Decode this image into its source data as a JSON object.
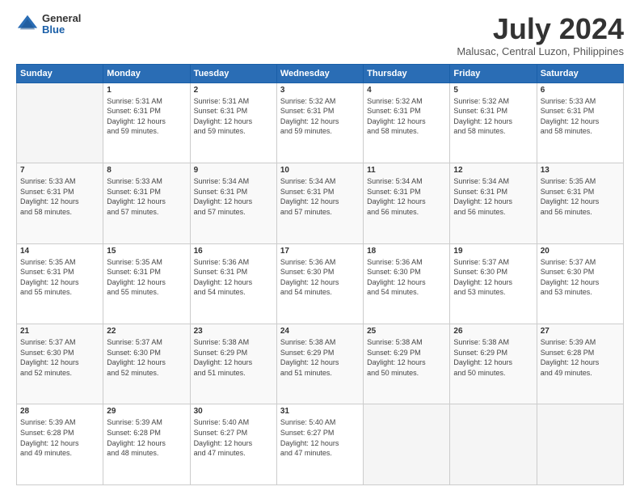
{
  "logo": {
    "general": "General",
    "blue": "Blue"
  },
  "title": "July 2024",
  "location": "Malusac, Central Luzon, Philippines",
  "days_header": [
    "Sunday",
    "Monday",
    "Tuesday",
    "Wednesday",
    "Thursday",
    "Friday",
    "Saturday"
  ],
  "weeks": [
    [
      {
        "num": "",
        "info": ""
      },
      {
        "num": "1",
        "info": "Sunrise: 5:31 AM\nSunset: 6:31 PM\nDaylight: 12 hours\nand 59 minutes."
      },
      {
        "num": "2",
        "info": "Sunrise: 5:31 AM\nSunset: 6:31 PM\nDaylight: 12 hours\nand 59 minutes."
      },
      {
        "num": "3",
        "info": "Sunrise: 5:32 AM\nSunset: 6:31 PM\nDaylight: 12 hours\nand 59 minutes."
      },
      {
        "num": "4",
        "info": "Sunrise: 5:32 AM\nSunset: 6:31 PM\nDaylight: 12 hours\nand 58 minutes."
      },
      {
        "num": "5",
        "info": "Sunrise: 5:32 AM\nSunset: 6:31 PM\nDaylight: 12 hours\nand 58 minutes."
      },
      {
        "num": "6",
        "info": "Sunrise: 5:33 AM\nSunset: 6:31 PM\nDaylight: 12 hours\nand 58 minutes."
      }
    ],
    [
      {
        "num": "7",
        "info": "Sunrise: 5:33 AM\nSunset: 6:31 PM\nDaylight: 12 hours\nand 58 minutes."
      },
      {
        "num": "8",
        "info": "Sunrise: 5:33 AM\nSunset: 6:31 PM\nDaylight: 12 hours\nand 57 minutes."
      },
      {
        "num": "9",
        "info": "Sunrise: 5:34 AM\nSunset: 6:31 PM\nDaylight: 12 hours\nand 57 minutes."
      },
      {
        "num": "10",
        "info": "Sunrise: 5:34 AM\nSunset: 6:31 PM\nDaylight: 12 hours\nand 57 minutes."
      },
      {
        "num": "11",
        "info": "Sunrise: 5:34 AM\nSunset: 6:31 PM\nDaylight: 12 hours\nand 56 minutes."
      },
      {
        "num": "12",
        "info": "Sunrise: 5:34 AM\nSunset: 6:31 PM\nDaylight: 12 hours\nand 56 minutes."
      },
      {
        "num": "13",
        "info": "Sunrise: 5:35 AM\nSunset: 6:31 PM\nDaylight: 12 hours\nand 56 minutes."
      }
    ],
    [
      {
        "num": "14",
        "info": "Sunrise: 5:35 AM\nSunset: 6:31 PM\nDaylight: 12 hours\nand 55 minutes."
      },
      {
        "num": "15",
        "info": "Sunrise: 5:35 AM\nSunset: 6:31 PM\nDaylight: 12 hours\nand 55 minutes."
      },
      {
        "num": "16",
        "info": "Sunrise: 5:36 AM\nSunset: 6:31 PM\nDaylight: 12 hours\nand 54 minutes."
      },
      {
        "num": "17",
        "info": "Sunrise: 5:36 AM\nSunset: 6:30 PM\nDaylight: 12 hours\nand 54 minutes."
      },
      {
        "num": "18",
        "info": "Sunrise: 5:36 AM\nSunset: 6:30 PM\nDaylight: 12 hours\nand 54 minutes."
      },
      {
        "num": "19",
        "info": "Sunrise: 5:37 AM\nSunset: 6:30 PM\nDaylight: 12 hours\nand 53 minutes."
      },
      {
        "num": "20",
        "info": "Sunrise: 5:37 AM\nSunset: 6:30 PM\nDaylight: 12 hours\nand 53 minutes."
      }
    ],
    [
      {
        "num": "21",
        "info": "Sunrise: 5:37 AM\nSunset: 6:30 PM\nDaylight: 12 hours\nand 52 minutes."
      },
      {
        "num": "22",
        "info": "Sunrise: 5:37 AM\nSunset: 6:30 PM\nDaylight: 12 hours\nand 52 minutes."
      },
      {
        "num": "23",
        "info": "Sunrise: 5:38 AM\nSunset: 6:29 PM\nDaylight: 12 hours\nand 51 minutes."
      },
      {
        "num": "24",
        "info": "Sunrise: 5:38 AM\nSunset: 6:29 PM\nDaylight: 12 hours\nand 51 minutes."
      },
      {
        "num": "25",
        "info": "Sunrise: 5:38 AM\nSunset: 6:29 PM\nDaylight: 12 hours\nand 50 minutes."
      },
      {
        "num": "26",
        "info": "Sunrise: 5:38 AM\nSunset: 6:29 PM\nDaylight: 12 hours\nand 50 minutes."
      },
      {
        "num": "27",
        "info": "Sunrise: 5:39 AM\nSunset: 6:28 PM\nDaylight: 12 hours\nand 49 minutes."
      }
    ],
    [
      {
        "num": "28",
        "info": "Sunrise: 5:39 AM\nSunset: 6:28 PM\nDaylight: 12 hours\nand 49 minutes."
      },
      {
        "num": "29",
        "info": "Sunrise: 5:39 AM\nSunset: 6:28 PM\nDaylight: 12 hours\nand 48 minutes."
      },
      {
        "num": "30",
        "info": "Sunrise: 5:40 AM\nSunset: 6:27 PM\nDaylight: 12 hours\nand 47 minutes."
      },
      {
        "num": "31",
        "info": "Sunrise: 5:40 AM\nSunset: 6:27 PM\nDaylight: 12 hours\nand 47 minutes."
      },
      {
        "num": "",
        "info": ""
      },
      {
        "num": "",
        "info": ""
      },
      {
        "num": "",
        "info": ""
      }
    ]
  ]
}
